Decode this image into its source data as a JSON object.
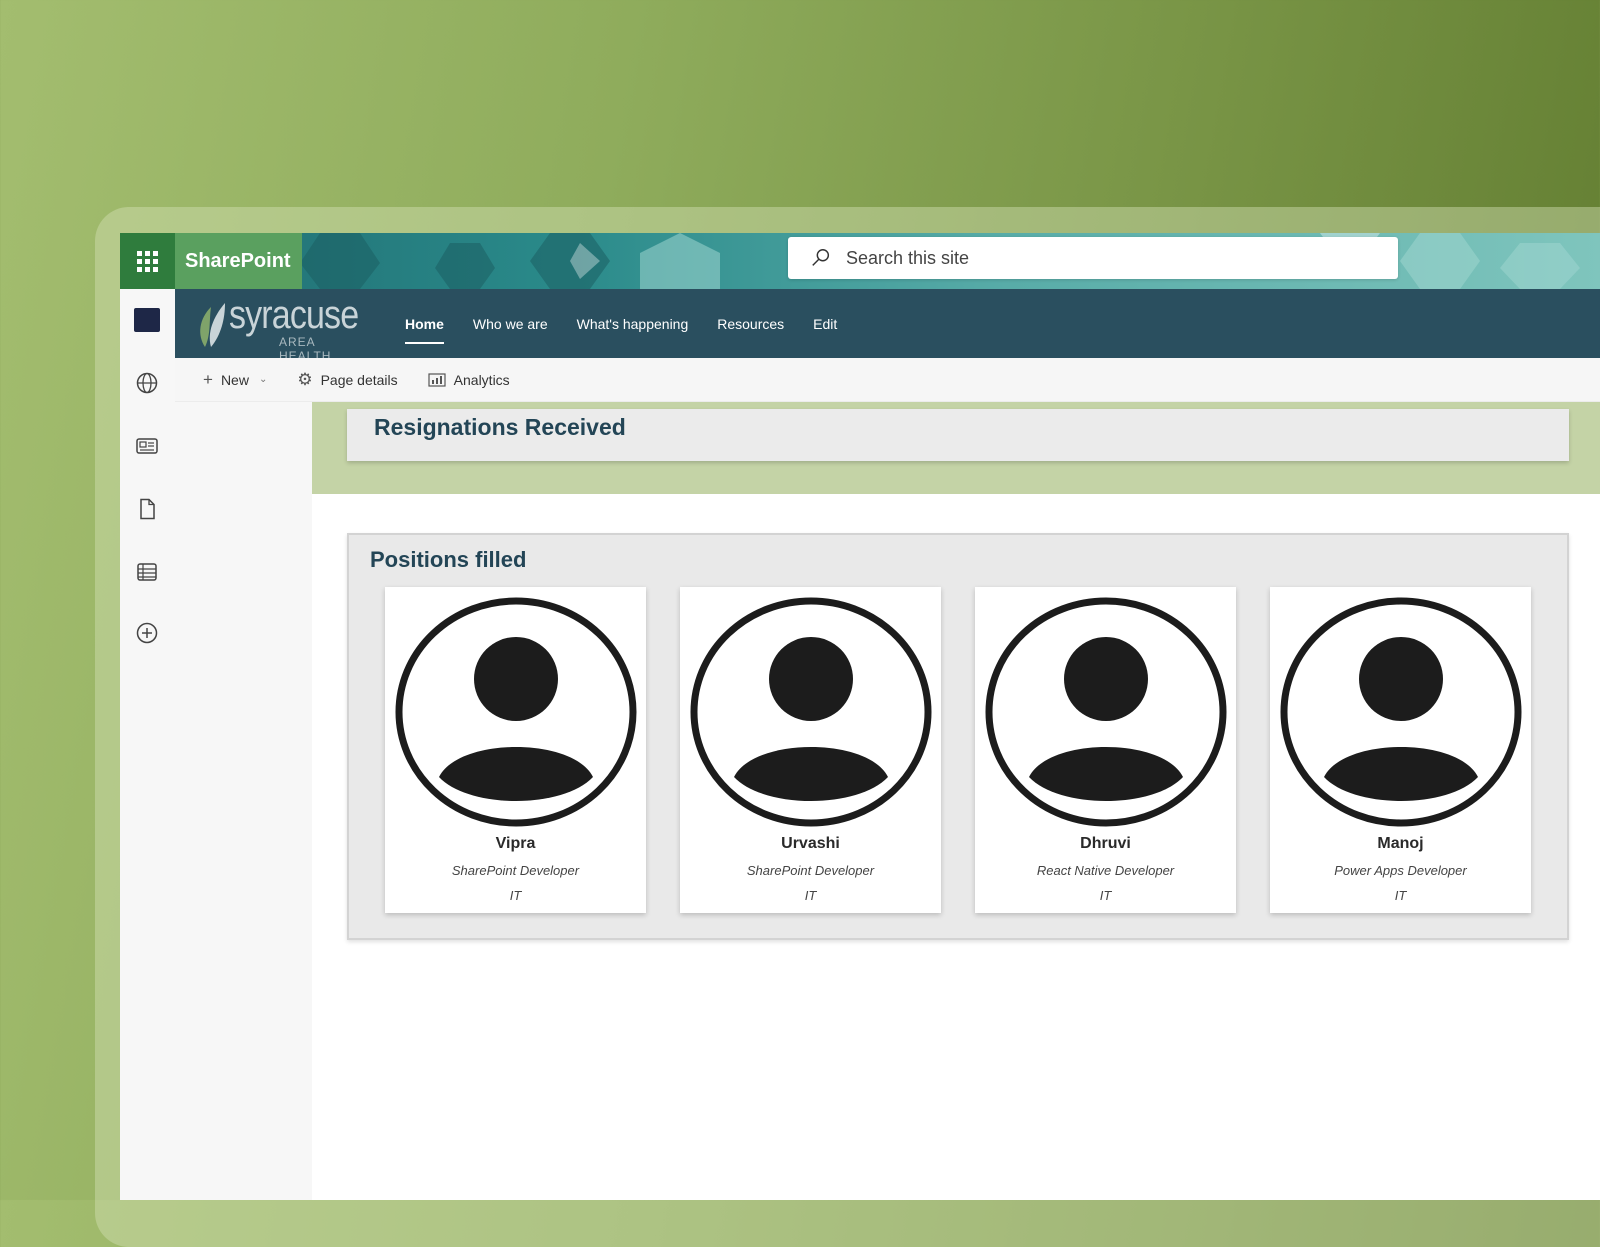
{
  "suite": {
    "app_name": "SharePoint",
    "search_placeholder": "Search this site",
    "waffle_icon": "app-launcher-icon"
  },
  "site": {
    "logo_text": "syracuse",
    "logo_subtext": "AREA HEALTH",
    "nav": [
      {
        "label": "Home",
        "active": true
      },
      {
        "label": "Who we are",
        "active": false
      },
      {
        "label": "What's happening",
        "active": false
      },
      {
        "label": "Resources",
        "active": false
      },
      {
        "label": "Edit",
        "active": false
      }
    ]
  },
  "rail": {
    "icons": [
      "site-logo-icon",
      "globe-icon",
      "news-icon",
      "file-icon",
      "list-icon",
      "add-circle-icon"
    ]
  },
  "commands": {
    "new_label": "New",
    "page_details_label": "Page details",
    "analytics_label": "Analytics"
  },
  "resignations": {
    "title": "Resignations Received"
  },
  "positions": {
    "title": "Positions filled",
    "people": [
      {
        "name": "Vipra",
        "role": "SharePoint Developer",
        "dept": "IT"
      },
      {
        "name": "Urvashi",
        "role": "SharePoint Developer",
        "dept": "IT"
      },
      {
        "name": "Dhruvi",
        "role": "React Native Developer",
        "dept": "IT"
      },
      {
        "name": "Manoj",
        "role": "Power Apps Developer",
        "dept": "IT"
      }
    ]
  },
  "colors": {
    "brand_green": "#5aa05f",
    "header_teal": "#2a4f5f",
    "heading_text": "#234556",
    "band_green": "#c4d3a6"
  }
}
